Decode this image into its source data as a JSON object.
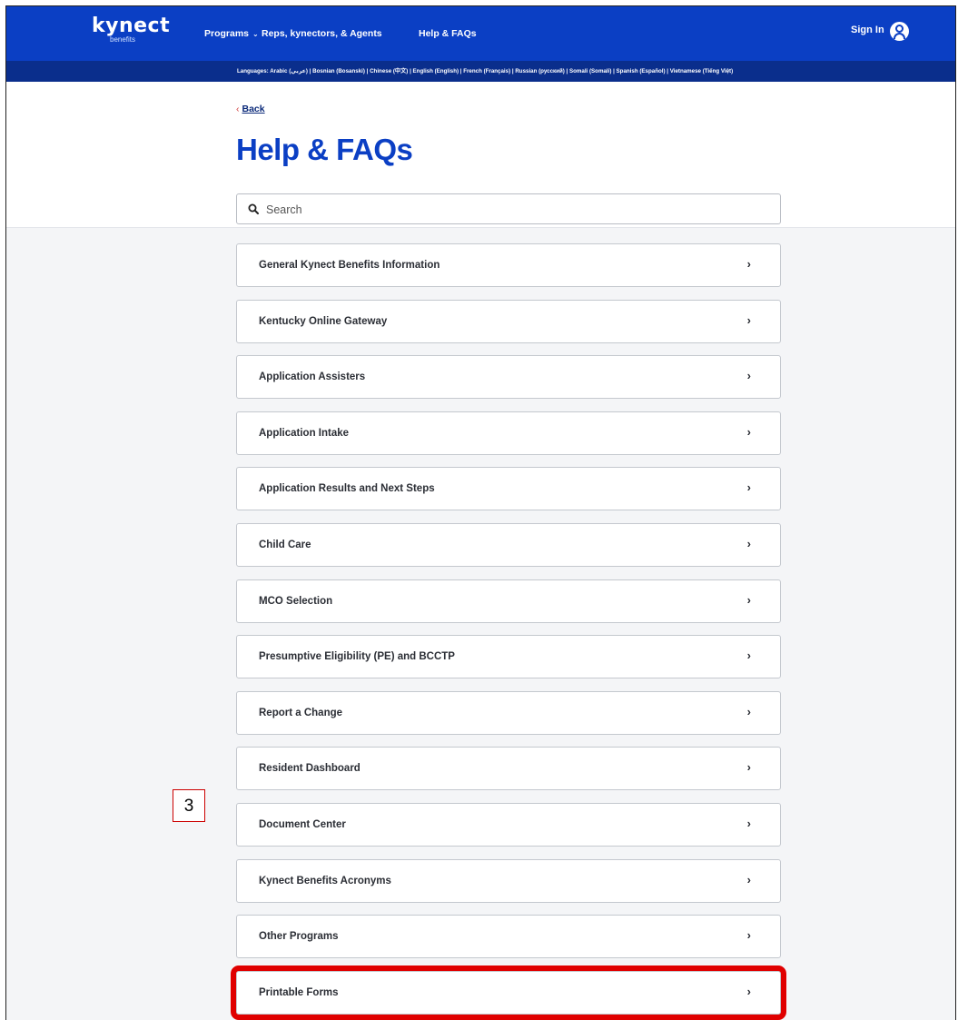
{
  "nav": {
    "logo_main": "kynect",
    "logo_sub": "benefits",
    "links": [
      {
        "label": "Programs",
        "has_dropdown": true
      },
      {
        "label": "Reps, kynectors, & Agents"
      },
      {
        "label": "Help & FAQs"
      }
    ],
    "sign_in": "Sign In",
    "colors": {
      "primary": "#0b3fc4",
      "language_bar": "#0a2e8c"
    }
  },
  "languages_text": "Languages: Arabic (عربي) | Bosnian (Bosanski) | Chinese (中文) | English (English) | French (Français) | Russian (русский) | Somali (Somali) | Spanish (Español) | Vietnamese (Tiếng Việt)",
  "header": {
    "back_label": "Back",
    "title": "Help & FAQs"
  },
  "search": {
    "placeholder": "Search"
  },
  "faq_items": [
    {
      "label": "General Kynect Benefits Information"
    },
    {
      "label": "Kentucky Online Gateway"
    },
    {
      "label": "Application Assisters"
    },
    {
      "label": "Application Intake"
    },
    {
      "label": "Application Results and Next Steps"
    },
    {
      "label": "Child Care"
    },
    {
      "label": "MCO Selection"
    },
    {
      "label": "Presumptive Eligibility (PE) and BCCTP"
    },
    {
      "label": "Report a Change"
    },
    {
      "label": "Resident Dashboard"
    },
    {
      "label": "Document Center"
    },
    {
      "label": "Kynect Benefits Acronyms"
    },
    {
      "label": "Other Programs"
    },
    {
      "label": "Printable Forms",
      "highlighted": true
    }
  ],
  "annotation": {
    "step_number": "3",
    "highlight_color": "#e00000"
  }
}
